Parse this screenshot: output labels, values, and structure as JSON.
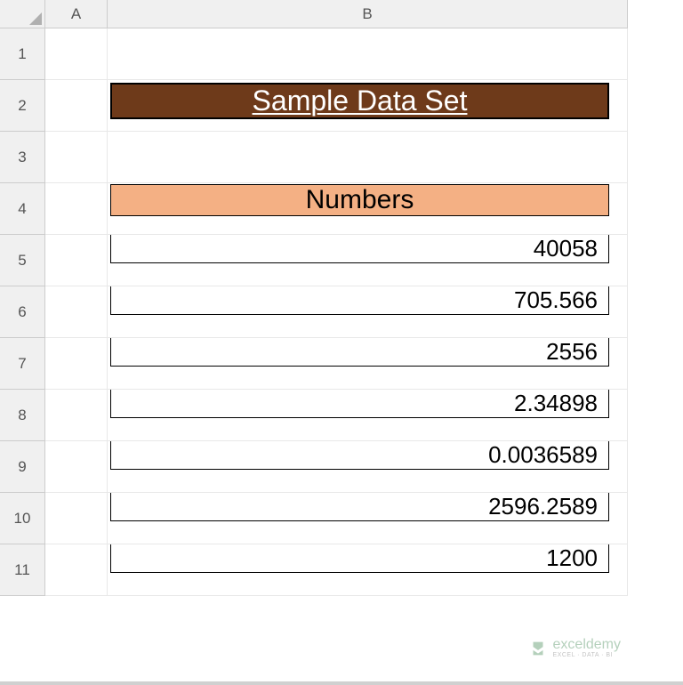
{
  "columns": {
    "A": "A",
    "B": "B"
  },
  "rows": [
    "1",
    "2",
    "3",
    "4",
    "5",
    "6",
    "7",
    "8",
    "9",
    "10",
    "11"
  ],
  "title": "Sample Data Set",
  "tableHeader": "Numbers",
  "chart_data": {
    "type": "table",
    "title": "Sample Data Set",
    "columns": [
      "Numbers"
    ],
    "values": [
      40058,
      705.566,
      2556,
      2.34898,
      0.0036589,
      2596.2589,
      1200
    ]
  },
  "tableData": {
    "r5": "40058",
    "r6": "705.566",
    "r7": "2556",
    "r8": "2.34898",
    "r9": "0.0036589",
    "r10": "2596.2589",
    "r11": "1200"
  },
  "watermark": {
    "main": "exceldemy",
    "sub": "EXCEL · DATA · BI"
  }
}
